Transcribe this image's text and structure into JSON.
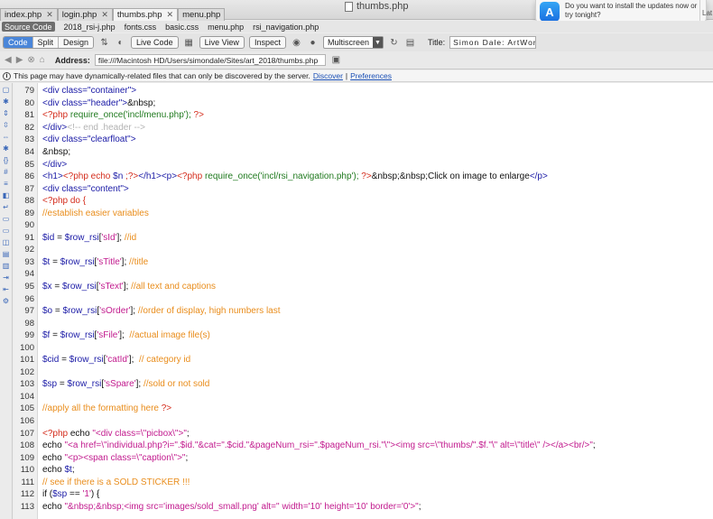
{
  "window": {
    "title": "thumbs.php"
  },
  "tabs": [
    {
      "label": "index.php",
      "active": false
    },
    {
      "label": "login.php",
      "active": false
    },
    {
      "label": "thumbs.php",
      "active": true
    },
    {
      "label": "menu.php",
      "active": false
    }
  ],
  "notification": {
    "text": "Do you want to install the updates now or try tonight?",
    "later": "Lat"
  },
  "related_files": {
    "source_code": "Source Code",
    "files": [
      "2018_rsi-j.php",
      "fonts.css",
      "basic.css",
      "menu.php",
      "rsi_navigation.php"
    ]
  },
  "toolbar": {
    "view_modes": [
      {
        "label": "Code",
        "active": true
      },
      {
        "label": "Split",
        "active": false
      },
      {
        "label": "Design",
        "active": false
      }
    ],
    "live_code": "Live Code",
    "live_view": "Live View",
    "inspect": "Inspect",
    "multiscreen": "Multiscreen",
    "title_label": "Title:",
    "title_value": "Simon Dale: ArtWork"
  },
  "address": {
    "label": "Address:",
    "value": "file:///Macintosh HD/Users/simondale/Sites/art_2018/thumbs.php"
  },
  "info": {
    "text": "This page may have dynamically-related files that can only be discovered by the server.",
    "discover": "Discover",
    "separator": "|",
    "preferences": "Preferences"
  },
  "code_lines": [
    {
      "n": "79",
      "parts": [
        [
          "t",
          "<div class=\"container\">"
        ]
      ]
    },
    {
      "n": "80",
      "parts": [
        [
          "t",
          "<div class=\"header\">"
        ],
        [
          "n",
          "&nbsp;"
        ]
      ]
    },
    {
      "n": "81",
      "parts": [
        [
          "p",
          "<?php "
        ],
        [
          "g",
          "require_once('incl/menu.php'); "
        ],
        [
          "p",
          "?>"
        ]
      ]
    },
    {
      "n": "82",
      "parts": [
        [
          "t",
          "</div>"
        ],
        [
          "h",
          "<!-- end .header -->"
        ]
      ]
    },
    {
      "n": "83",
      "parts": [
        [
          "t",
          "<div class=\"clearfloat\">"
        ]
      ]
    },
    {
      "n": "84",
      "parts": [
        [
          "n",
          "&nbsp;"
        ]
      ]
    },
    {
      "n": "85",
      "parts": [
        [
          "t",
          "</div>"
        ]
      ]
    },
    {
      "n": "86",
      "parts": [
        [
          "t",
          "<h1>"
        ],
        [
          "p",
          "<?php echo "
        ],
        [
          "v",
          "$n "
        ],
        [
          "p",
          ";?>"
        ],
        [
          "t",
          "</h1><p>"
        ],
        [
          "p",
          "<?php "
        ],
        [
          "g",
          "require_once('incl/rsi_navigation.php'); "
        ],
        [
          "p",
          "?>"
        ],
        [
          "n",
          "&nbsp;&nbsp;Click on image to enlarge"
        ],
        [
          "t",
          "</p>"
        ]
      ]
    },
    {
      "n": "87",
      "parts": [
        [
          "t",
          "<div class=\"content\">"
        ]
      ]
    },
    {
      "n": "88",
      "parts": [
        [
          "p",
          "<?php do {"
        ]
      ]
    },
    {
      "n": "89",
      "parts": [
        [
          "c",
          "//establish easier variables"
        ]
      ]
    },
    {
      "n": "90",
      "parts": []
    },
    {
      "n": "91",
      "parts": [
        [
          "v",
          "$id"
        ],
        [
          "n",
          " = "
        ],
        [
          "v",
          "$row_rsi"
        ],
        [
          "n",
          "["
        ],
        [
          "s",
          "'sId'"
        ],
        [
          "n",
          "]; "
        ],
        [
          "c",
          "//id"
        ]
      ]
    },
    {
      "n": "92",
      "parts": []
    },
    {
      "n": "93",
      "parts": [
        [
          "v",
          "$t"
        ],
        [
          "n",
          " = "
        ],
        [
          "v",
          "$row_rsi"
        ],
        [
          "n",
          "["
        ],
        [
          "s",
          "'sTitle'"
        ],
        [
          "n",
          "]; "
        ],
        [
          "c",
          "//title"
        ]
      ]
    },
    {
      "n": "94",
      "parts": []
    },
    {
      "n": "95",
      "parts": [
        [
          "v",
          "$x"
        ],
        [
          "n",
          " = "
        ],
        [
          "v",
          "$row_rsi"
        ],
        [
          "n",
          "["
        ],
        [
          "s",
          "'sText'"
        ],
        [
          "n",
          "]; "
        ],
        [
          "c",
          "//all text and captions"
        ]
      ]
    },
    {
      "n": "96",
      "parts": []
    },
    {
      "n": "97",
      "parts": [
        [
          "v",
          "$o"
        ],
        [
          "n",
          " = "
        ],
        [
          "v",
          "$row_rsi"
        ],
        [
          "n",
          "["
        ],
        [
          "s",
          "'sOrder'"
        ],
        [
          "n",
          "]; "
        ],
        [
          "c",
          "//order of display, high numbers last"
        ]
      ]
    },
    {
      "n": "98",
      "parts": []
    },
    {
      "n": "99",
      "parts": [
        [
          "v",
          "$f"
        ],
        [
          "n",
          " = "
        ],
        [
          "v",
          "$row_rsi"
        ],
        [
          "n",
          "["
        ],
        [
          "s",
          "'sFile'"
        ],
        [
          "n",
          "];  "
        ],
        [
          "c",
          "//actual image file(s)"
        ]
      ]
    },
    {
      "n": "100",
      "parts": []
    },
    {
      "n": "101",
      "parts": [
        [
          "v",
          "$cid"
        ],
        [
          "n",
          " = "
        ],
        [
          "v",
          "$row_rsi"
        ],
        [
          "n",
          "["
        ],
        [
          "s",
          "'catId'"
        ],
        [
          "n",
          "];  "
        ],
        [
          "c",
          "// category id"
        ]
      ]
    },
    {
      "n": "102",
      "parts": []
    },
    {
      "n": "103",
      "parts": [
        [
          "v",
          "$sp"
        ],
        [
          "n",
          " = "
        ],
        [
          "v",
          "$row_rsi"
        ],
        [
          "n",
          "["
        ],
        [
          "s",
          "'sSpare'"
        ],
        [
          "n",
          "]; "
        ],
        [
          "c",
          "//sold or not sold"
        ]
      ]
    },
    {
      "n": "104",
      "parts": []
    },
    {
      "n": "105",
      "parts": [
        [
          "c",
          "//apply all the formatting here "
        ],
        [
          "p",
          "?>"
        ]
      ]
    },
    {
      "n": "106",
      "parts": []
    },
    {
      "n": "107",
      "parts": [
        [
          "p",
          "<?php "
        ],
        [
          "n",
          "echo "
        ],
        [
          "s",
          "\"<div class=\\\"picbox\\\">\""
        ],
        [
          "n",
          ";"
        ]
      ]
    },
    {
      "n": "108",
      "parts": [
        [
          "n",
          "echo "
        ],
        [
          "s",
          "\"<a href=\\\"individual.php?i=\".$id.\"&cat=\".$cid.\"&pageNum_rsi=\".$pageNum_rsi.\"\\\"><img src=\\\"thumbs/\".$f.\"\\\" alt=\\\"title\\\" /></a><br/>\""
        ],
        [
          "n",
          ";"
        ]
      ]
    },
    {
      "n": "109",
      "parts": [
        [
          "n",
          "echo "
        ],
        [
          "s",
          "\"<p><span class=\\\"caption\\\">\""
        ],
        [
          "n",
          ";"
        ]
      ]
    },
    {
      "n": "110",
      "parts": [
        [
          "n",
          "echo "
        ],
        [
          "v",
          "$t"
        ],
        [
          "n",
          ";"
        ]
      ]
    },
    {
      "n": "111",
      "parts": [
        [
          "c",
          "// see if there is a SOLD STICKER !!!"
        ]
      ]
    },
    {
      "n": "112",
      "parts": [
        [
          "n",
          "if ("
        ],
        [
          "v",
          "$sp"
        ],
        [
          "n",
          " == "
        ],
        [
          "s",
          "'1'"
        ],
        [
          "n",
          ") {"
        ]
      ]
    },
    {
      "n": "113",
      "parts": [
        [
          "n",
          "echo "
        ],
        [
          "s",
          "\"&nbsp;&nbsp;<img src='images/sold_small.png' alt='' width='10' height='10' border='0'>\""
        ],
        [
          "n",
          ";"
        ]
      ]
    }
  ]
}
